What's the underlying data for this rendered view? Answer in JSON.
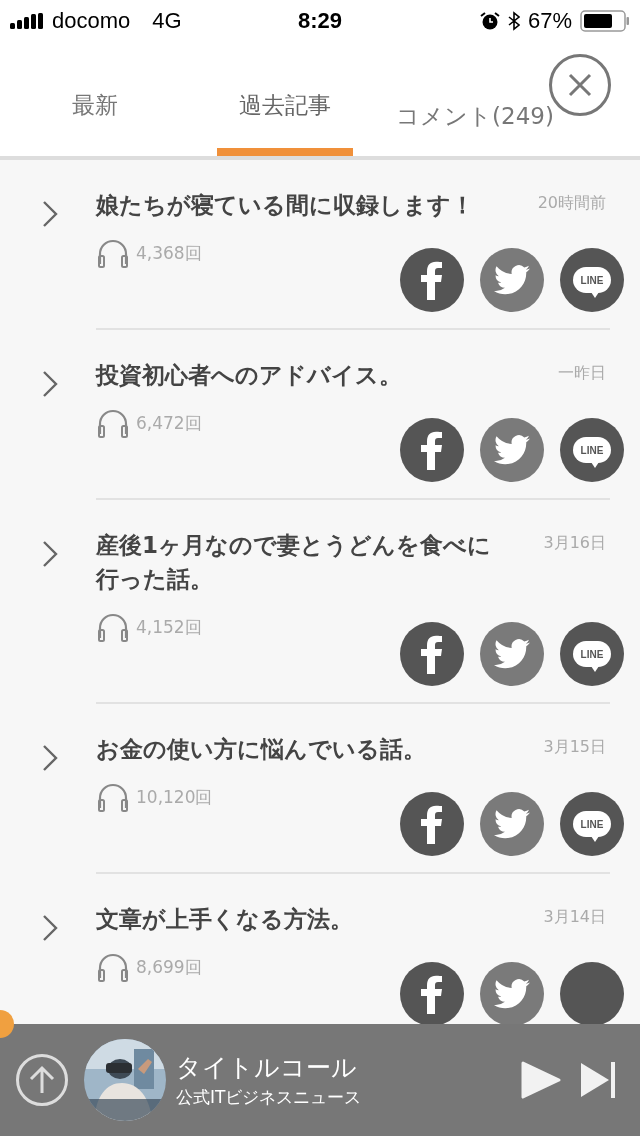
{
  "status_bar": {
    "carrier": "docomo",
    "network": "4G",
    "time": "8:29",
    "battery": "67%"
  },
  "tabs": [
    {
      "label": "最新",
      "selected": false
    },
    {
      "label": "過去記事",
      "selected": true
    },
    {
      "label": "コメント(249)",
      "selected": false
    }
  ],
  "articles": [
    {
      "title": "娘たちが寝ている間に収録します！",
      "date": "20時間前",
      "plays": "4,368回",
      "line_label": "LINE"
    },
    {
      "title": "投資初心者へのアドバイス。",
      "date": "一昨日",
      "plays": "6,472回",
      "line_label": "LINE"
    },
    {
      "title": "産後1ヶ月なので妻とうどんを食べに行った話。",
      "date": "3月16日",
      "plays": "4,152回",
      "line_label": "LINE"
    },
    {
      "title": "お金の使い方に悩んでいる話。",
      "date": "3月15日",
      "plays": "10,120回",
      "line_label": "LINE"
    },
    {
      "title": "文章が上手くなる方法。",
      "date": "3月14日",
      "plays": "8,699回"
    }
  ],
  "player": {
    "title": "タイトルコール",
    "channel": "公式ITビジネスニュース"
  }
}
